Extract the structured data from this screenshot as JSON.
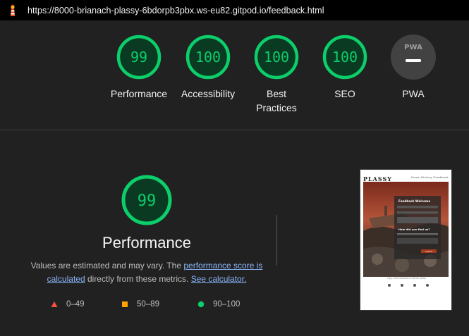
{
  "topbar": {
    "url": "https://8000-brianach-plassy-6bdorpb3pbx.ws-eu82.gitpod.io/feedback.html",
    "logo_icon": "lighthouse-icon"
  },
  "summary": [
    {
      "score": "99",
      "label": "Performance"
    },
    {
      "score": "100",
      "label": "Accessibility"
    },
    {
      "score": "100",
      "label": "Best Practices"
    },
    {
      "score": "100",
      "label": "SEO"
    },
    {
      "score": "",
      "label": "PWA",
      "badge": "PWA"
    }
  ],
  "performance": {
    "score": "99",
    "title": "Performance",
    "desc_before": "Values are estimated and may vary. The ",
    "link_score": "performance score is calculated",
    "desc_mid": " directly from these metrics. ",
    "link_calc": "See calculator."
  },
  "legend": [
    {
      "range": "0–49",
      "shape": "triangle",
      "color": "#ff4e42"
    },
    {
      "range": "50–89",
      "shape": "square",
      "color": "#ffa400"
    },
    {
      "range": "90–100",
      "shape": "circle",
      "color": "#0cce6b"
    }
  ],
  "thumbnail": {
    "brand": "PLASSY",
    "nav": "Home  History  Feedback",
    "form_title": "Feedback Welcome",
    "form_question": "How did you find us?",
    "submit": "Submit",
    "footer": "copy; Green Anderson & Bernie plassy"
  },
  "colors": {
    "pass": "#0cce6b",
    "pass_bg": "#0b3a22",
    "na_bg": "#424242"
  }
}
